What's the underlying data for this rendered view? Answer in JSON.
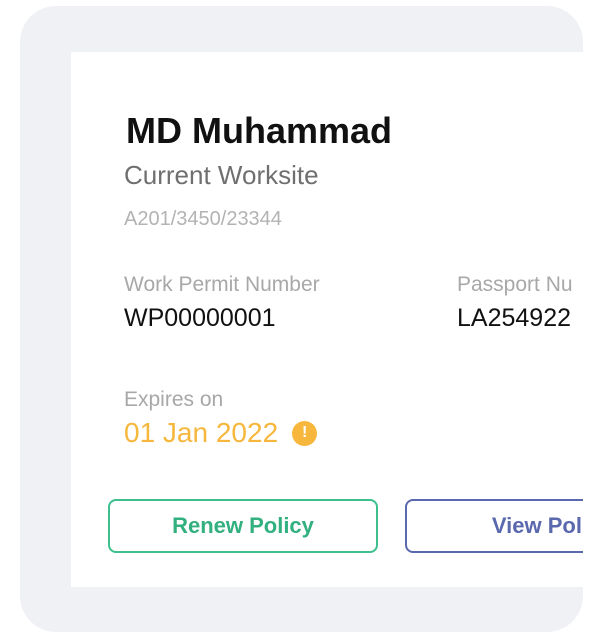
{
  "worker": {
    "name": "MD Muhammad",
    "worksite_label": "Current Worksite",
    "worksite_code": "A201/3450/23344"
  },
  "work_permit": {
    "label": "Work Permit Number",
    "value": "WP00000001"
  },
  "passport": {
    "label": "Passport Nu",
    "value": "LA254922"
  },
  "expiry": {
    "label": "Expires on",
    "value": "01 Jan 2022",
    "warning_icon": "exclamation-circle-icon",
    "color": "#f6b73c"
  },
  "actions": {
    "renew_label": "Renew Policy",
    "view_label": "View Poli"
  },
  "colors": {
    "renew": "#32b07f",
    "view": "#5a68ad",
    "warning": "#f6b73c"
  }
}
